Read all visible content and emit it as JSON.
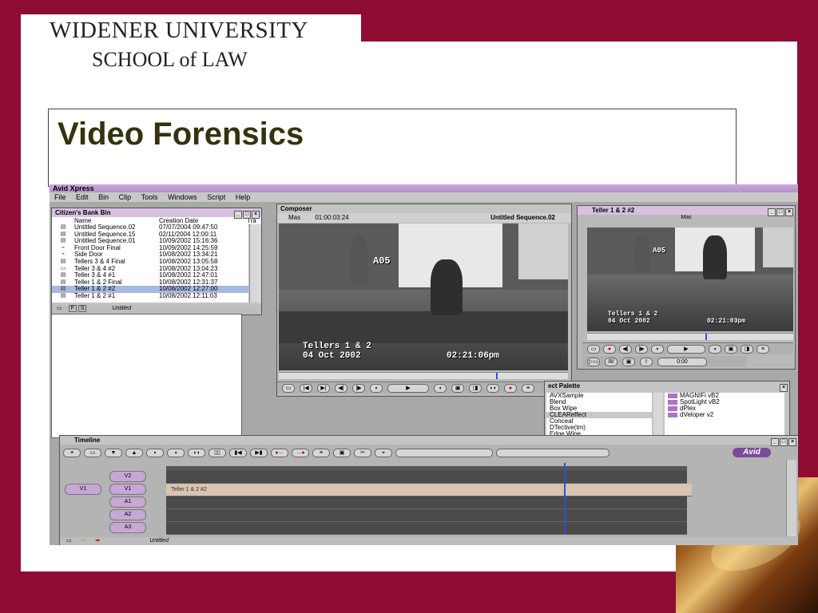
{
  "slide": {
    "logo_line1": "WIDENER UNIVERSITY",
    "logo_line2": "SCHOOL of LAW",
    "title": "Video Forensics"
  },
  "app": {
    "title": "Avid Xpress",
    "menu": [
      "File",
      "Edit",
      "Bin",
      "Clip",
      "Tools",
      "Windows",
      "Script",
      "Help"
    ]
  },
  "bin": {
    "title": "Citizen's Bank Bin",
    "col_name": "Name",
    "col_date": "Creation Date",
    "col_extra": "Tra",
    "rows": [
      {
        "name": "Untitled Sequence.02",
        "date": "07/07/2004 09:47:50"
      },
      {
        "name": "Untitled Sequence.15",
        "date": "02/11/2004 12:00:11"
      },
      {
        "name": "Untitled Sequence.01",
        "date": "10/09/2002 15:16:36"
      },
      {
        "name": "Front Door Final",
        "date": "10/09/2002 14:25:59"
      },
      {
        "name": "Side Door",
        "date": "10/08/2002 13:34:21"
      },
      {
        "name": "Tellers 3 & 4 Final",
        "date": "10/08/2002 13:05:58"
      },
      {
        "name": "Teller 3 & 4 #2",
        "date": "10/08/2002 13:04:23"
      },
      {
        "name": "Teller 3 & 4 #1",
        "date": "10/08/2002 12:47:01"
      },
      {
        "name": "Teller 1 & 2 Final",
        "date": "10/08/2002 12:31:37"
      },
      {
        "name": "Teller 1 & 2 #2",
        "date": "10/08/2002 12:27:00"
      },
      {
        "name": "Teller 1 & 2 #1",
        "date": "10/08/2002 12:11:03"
      }
    ],
    "footer_tabs": [
      "F",
      "S"
    ],
    "footer_label": "Untitled"
  },
  "composer": {
    "title": "Composer",
    "mas_label": "Mas",
    "timecode": "01:00:03:24",
    "sequence": "Untitled Sequence.02",
    "overlay_cam": "A05",
    "overlay_line1": "Tellers 1 & 2",
    "overlay_line2": "04 Oct 2002",
    "overlay_time": "02:21:06pm"
  },
  "teller_window": {
    "title": "Teller 1 & 2 #2",
    "mas_label": "Mas",
    "overlay_cam": "A05",
    "overlay_line1": "Tellers 1 & 2",
    "overlay_line2": "04 Oct 2002",
    "overlay_time": "02:21:03pm",
    "timecode": "0:00"
  },
  "effect_palette": {
    "title": "ect Palette",
    "categories": [
      "AVXSample",
      "Blend",
      "Box Wipe",
      "CLEAReffect",
      "Conceal",
      "DTective(tm)",
      "Edge Wipe"
    ],
    "selected_category": 3,
    "effects": [
      "MAGNIFi vB2",
      "SpotLight vB2",
      "dPlex",
      "dVeloper v2"
    ]
  },
  "timeline": {
    "title": "Timeline",
    "logo": "Avid",
    "tracks": [
      "V2",
      "V1",
      "A1",
      "A2",
      "A3"
    ],
    "source_track": "V1",
    "clip_label": "Teller 1 & 2 #2",
    "footer_label": "Untitled"
  }
}
